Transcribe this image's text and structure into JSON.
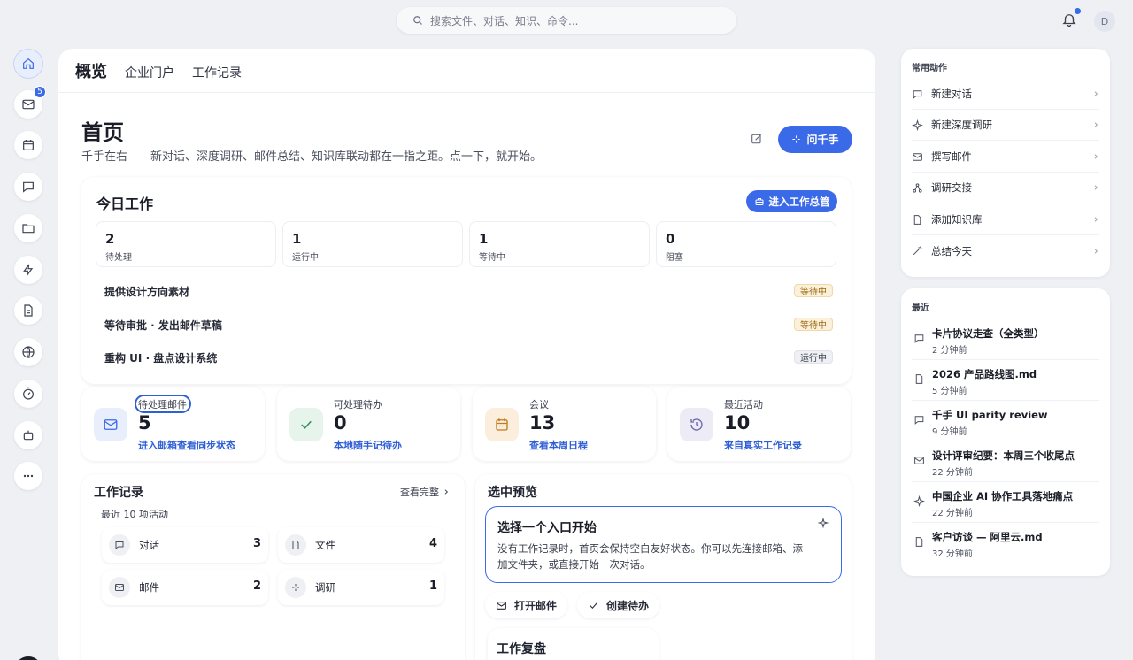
{
  "topbar": {
    "search_placeholder": "搜索文件、对话、知识、命令...",
    "avatar_initial": "D"
  },
  "rail": {
    "mail_badge": "5"
  },
  "tabs": [
    "概览",
    "企业门户",
    "工作记录"
  ],
  "header": {
    "title": "首页",
    "subtitle": "千手在右——新对话、深度调研、邮件总结、知识库联动都在一指之距。点一下，就开始。",
    "ask_label": "问千手"
  },
  "today": {
    "title": "今日工作",
    "enter_label": "进入工作总管",
    "stats": [
      {
        "value": "2",
        "label": "待处理"
      },
      {
        "value": "1",
        "label": "运行中"
      },
      {
        "value": "1",
        "label": "等待中"
      },
      {
        "value": "0",
        "label": "阻塞"
      }
    ],
    "tasks": [
      {
        "name": "提供设计方向素材",
        "status": "等待中"
      },
      {
        "name": "等待审批 · 发出邮件草稿",
        "status": "等待中"
      },
      {
        "name": "重构 UI · 盘点设计系统",
        "status": "运行中"
      }
    ]
  },
  "metrics": [
    {
      "label": "待处理邮件",
      "value": "5",
      "link": "进入邮箱查看同步状态",
      "icon": "mail-icon",
      "color": "#e8eefc"
    },
    {
      "label": "可处理待办",
      "value": "0",
      "link": "本地随手记待办",
      "icon": "check-icon",
      "color": "#e6f4ec"
    },
    {
      "label": "会议",
      "value": "13",
      "link": "查看本周日程",
      "icon": "calendar-icon",
      "color": "#fbeedd"
    },
    {
      "label": "最近活动",
      "value": "10",
      "link": "来自真实工作记录",
      "icon": "history-icon",
      "color": "#ecebf6"
    }
  ],
  "work_records": {
    "title": "工作记录",
    "subtitle": "最近 10 项活动",
    "more": "查看完整",
    "items": [
      {
        "name": "对话",
        "count": "3"
      },
      {
        "name": "文件",
        "count": "4"
      },
      {
        "name": "邮件",
        "count": "2"
      },
      {
        "name": "调研",
        "count": "1"
      }
    ]
  },
  "preview": {
    "title": "选中预览",
    "box_title": "选择一个入口开始",
    "box_text": "没有工作记录时，首页会保持空白友好状态。你可以先连接邮箱、添加文件夹，或直接开始一次对话。",
    "actions": [
      "打开邮件",
      "创建待办"
    ],
    "review_title": "工作复盘"
  },
  "quick_actions": {
    "title": "常用动作",
    "items": [
      "新建对话",
      "新建深度调研",
      "撰写邮件",
      "调研交接",
      "添加知识库",
      "总结今天"
    ]
  },
  "recent": {
    "title": "最近",
    "items": [
      {
        "title": "卡片协议走查（全类型）",
        "time": "2 分钟前"
      },
      {
        "title": "2026 产品路线图.md",
        "time": "5 分钟前"
      },
      {
        "title": "千手 UI parity review",
        "time": "9 分钟前"
      },
      {
        "title": "设计评审纪要：本周三个收尾点",
        "time": "22 分钟前"
      },
      {
        "title": "中国企业 AI 协作工具落地痛点",
        "time": "22 分钟前"
      },
      {
        "title": "客户访谈 — 阿里云.md",
        "time": "32 分钟前"
      }
    ]
  },
  "colors": {
    "accent": "#3b6ae8",
    "waiting_bg": "#fbf0da",
    "running_bg": "#eef0f4"
  }
}
